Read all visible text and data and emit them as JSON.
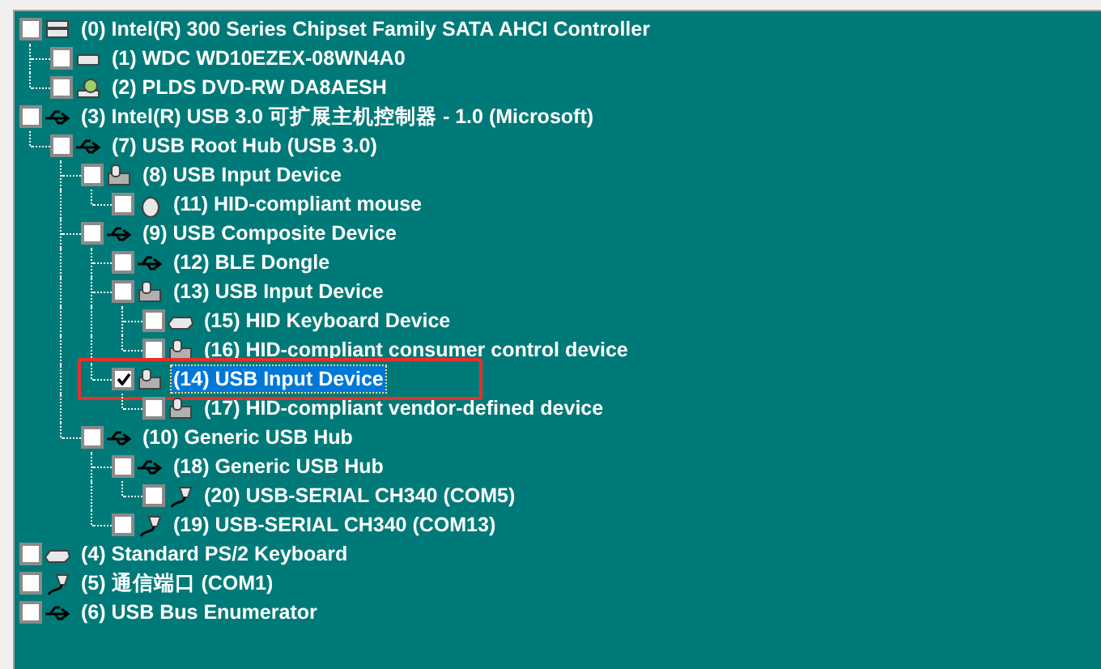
{
  "tree": [
    {
      "label": "(0) Intel(R) 300 Series Chipset Family SATA AHCI Controller",
      "kind": "controller",
      "checked": false,
      "selected": false,
      "children": [
        {
          "label": "(1) WDC WD10EZEX-08WN4A0",
          "kind": "drive",
          "checked": false,
          "selected": false
        },
        {
          "label": "(2) PLDS DVD-RW DA8AESH",
          "kind": "dvd",
          "checked": false,
          "selected": false
        }
      ]
    },
    {
      "label": "(3) Intel(R) USB 3.0 可扩展主机控制器 - 1.0 (Microsoft)",
      "kind": "usb",
      "checked": false,
      "selected": false,
      "children": [
        {
          "label": "(7) USB Root Hub (USB 3.0)",
          "kind": "usb",
          "checked": false,
          "selected": false,
          "children": [
            {
              "label": "(8) USB Input Device",
              "kind": "hid",
              "checked": false,
              "selected": false,
              "children": [
                {
                  "label": "(11) HID-compliant mouse",
                  "kind": "mouse",
                  "checked": false,
                  "selected": false
                }
              ]
            },
            {
              "label": "(9) USB Composite Device",
              "kind": "usb",
              "checked": false,
              "selected": false,
              "children": [
                {
                  "label": "(12) BLE Dongle",
                  "kind": "usb",
                  "checked": false,
                  "selected": false
                },
                {
                  "label": "(13) USB Input Device",
                  "kind": "hid",
                  "checked": false,
                  "selected": false,
                  "children": [
                    {
                      "label": "(15) HID Keyboard Device",
                      "kind": "keyboard",
                      "checked": false,
                      "selected": false
                    },
                    {
                      "label": "(16) HID-compliant consumer control device",
                      "kind": "hid",
                      "checked": false,
                      "selected": false
                    }
                  ]
                },
                {
                  "label": "(14) USB Input Device",
                  "kind": "hid",
                  "checked": true,
                  "selected": true,
                  "marked": true,
                  "children": [
                    {
                      "label": "(17) HID-compliant vendor-defined device",
                      "kind": "hid",
                      "checked": false,
                      "selected": false
                    }
                  ]
                }
              ]
            },
            {
              "label": "(10) Generic USB Hub",
              "kind": "usb",
              "checked": false,
              "selected": false,
              "children": [
                {
                  "label": "(18) Generic USB Hub",
                  "kind": "usb",
                  "checked": false,
                  "selected": false,
                  "children": [
                    {
                      "label": "(20) USB-SERIAL CH340 (COM5)",
                      "kind": "serial",
                      "checked": false,
                      "selected": false
                    }
                  ]
                },
                {
                  "label": "(19) USB-SERIAL CH340 (COM13)",
                  "kind": "serial",
                  "checked": false,
                  "selected": false
                }
              ]
            }
          ]
        }
      ]
    },
    {
      "label": "(4) Standard PS/2 Keyboard",
      "kind": "keyboard",
      "checked": false,
      "selected": false
    },
    {
      "label": "(5) 通信端口 (COM1)",
      "kind": "serial",
      "checked": false,
      "selected": false
    },
    {
      "label": "(6) USB Bus Enumerator",
      "kind": "usb",
      "checked": false,
      "selected": false
    }
  ]
}
